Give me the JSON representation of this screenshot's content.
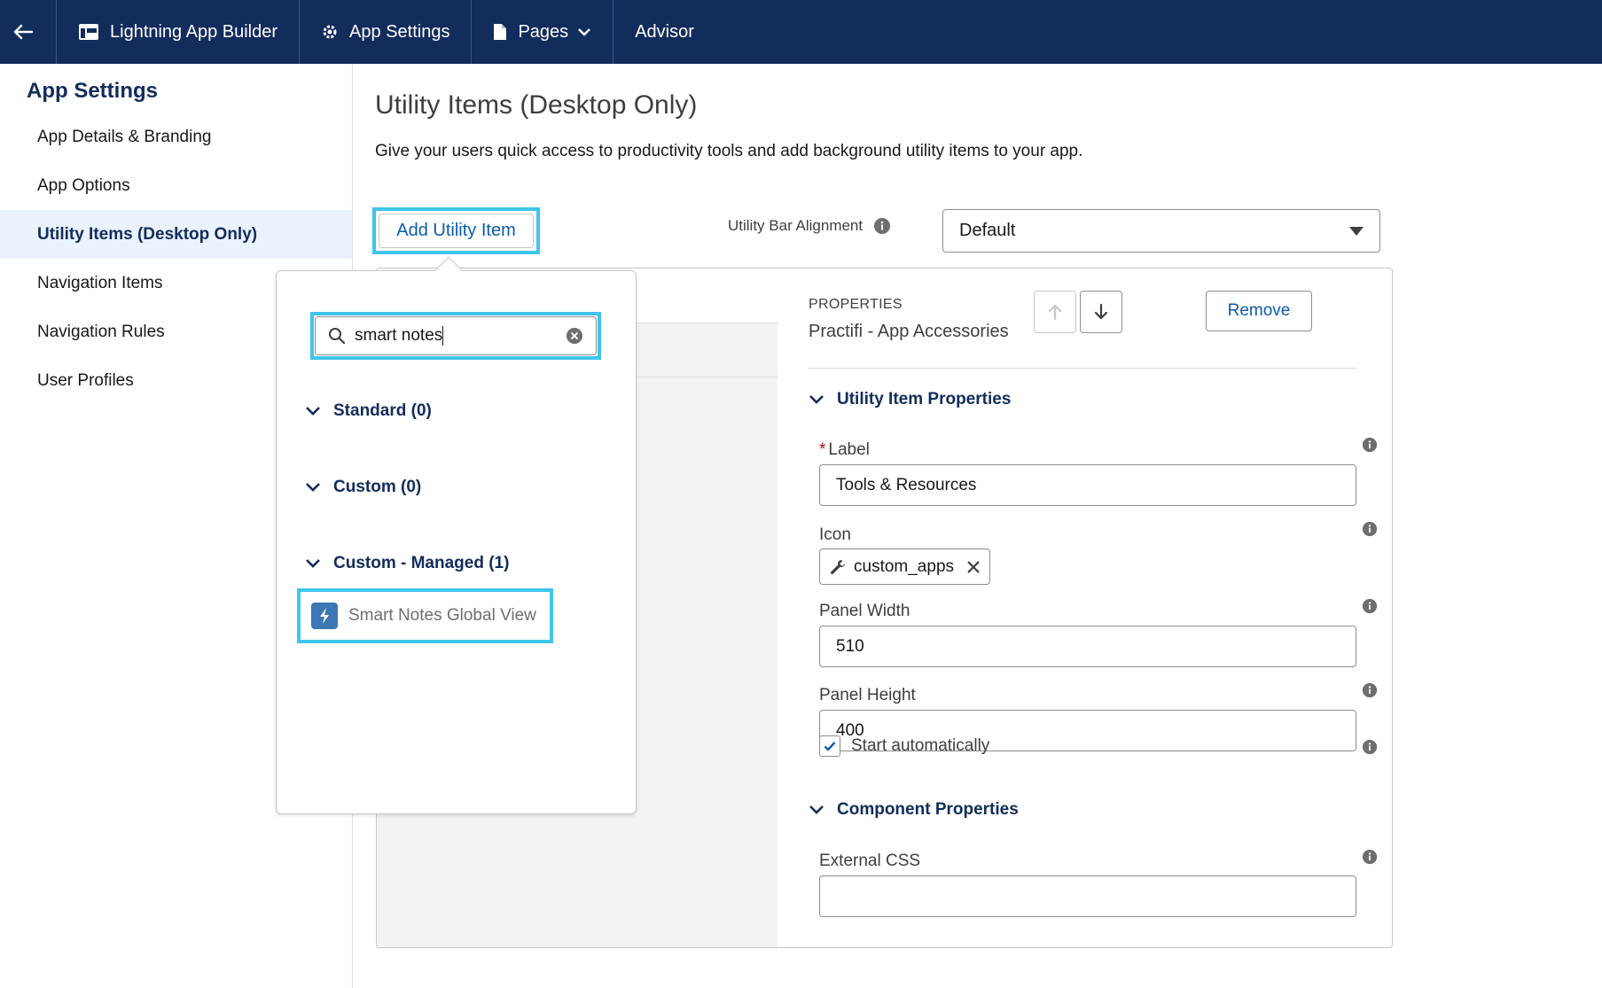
{
  "topnav": {
    "builder": "Lightning App Builder",
    "settings": "App Settings",
    "pages": "Pages",
    "advisor": "Advisor"
  },
  "sidebar": {
    "title": "App Settings",
    "items": [
      {
        "label": "App Details & Branding"
      },
      {
        "label": "App Options"
      },
      {
        "label": "Utility Items (Desktop Only)"
      },
      {
        "label": "Navigation Items"
      },
      {
        "label": "Navigation Rules"
      },
      {
        "label": "User Profiles"
      }
    ]
  },
  "main": {
    "title": "Utility Items (Desktop Only)",
    "description": "Give your users quick access to productivity tools and add background utility items to your app.",
    "add_button": "Add Utility Item",
    "alignment_label": "Utility Bar Alignment",
    "alignment_value": "Default"
  },
  "popover": {
    "search_value": "smart notes",
    "groups": [
      {
        "label": "Standard (0)"
      },
      {
        "label": "Custom (0)"
      },
      {
        "label": "Custom - Managed (1)"
      }
    ],
    "result": "Smart Notes Global View"
  },
  "properties": {
    "heading": "PROPERTIES",
    "name": "Practifi - App Accessories",
    "remove": "Remove",
    "utility_section": "Utility Item Properties",
    "label_label": "Label",
    "label_required": "*",
    "label_value": "Tools & Resources",
    "icon_label": "Icon",
    "icon_value": "custom_apps",
    "width_label": "Panel Width",
    "width_value": "510",
    "height_label": "Panel Height",
    "height_value": "400",
    "start_label": "Start automatically",
    "component_section": "Component Properties",
    "css_label": "External CSS",
    "css_value": ""
  },
  "colors": {
    "nav_bg": "#122c5c",
    "link": "#0b5cab",
    "highlight": "#3fc5ec",
    "active_bg": "#eaf2fc"
  }
}
